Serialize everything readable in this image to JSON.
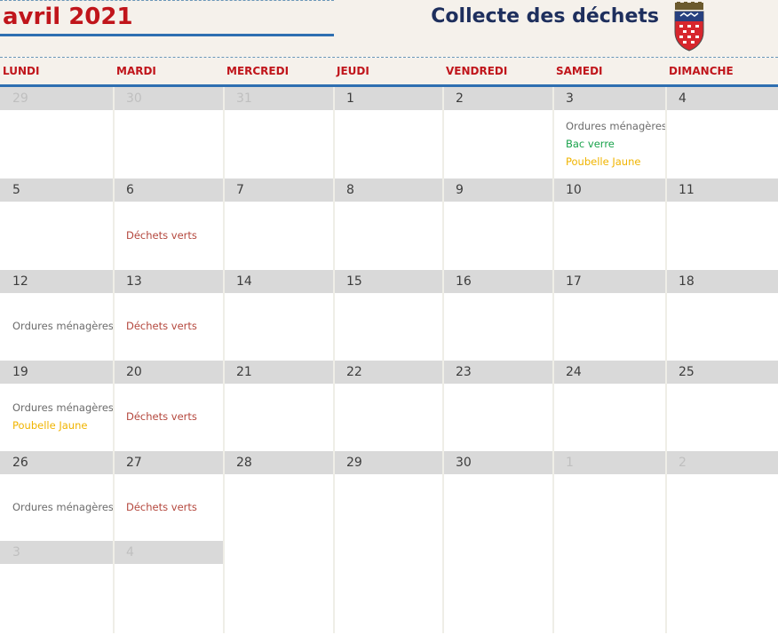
{
  "header": {
    "month_title": "avril 2021",
    "app_title": "Collecte des déchets",
    "crest_icon": "municipal-crest-icon"
  },
  "weekdays": [
    "LUNDI",
    "MARDI",
    "MERCREDI",
    "JEUDI",
    "VENDREDI",
    "SAMEDI",
    "DIMANCHE"
  ],
  "weeks": [
    [
      {
        "day": "29",
        "other_month": true,
        "events": []
      },
      {
        "day": "30",
        "other_month": true,
        "events": []
      },
      {
        "day": "31",
        "other_month": true,
        "events": []
      },
      {
        "day": "1",
        "other_month": false,
        "events": []
      },
      {
        "day": "2",
        "other_month": false,
        "events": []
      },
      {
        "day": "3",
        "other_month": false,
        "events": [
          {
            "label": "Ordures ménagères",
            "kind": "om"
          },
          {
            "label": "Bac verre",
            "kind": "verre"
          },
          {
            "label": "Poubelle Jaune",
            "kind": "jaune"
          }
        ]
      },
      {
        "day": "4",
        "other_month": false,
        "events": []
      }
    ],
    [
      {
        "day": "5",
        "other_month": false,
        "events": []
      },
      {
        "day": "6",
        "other_month": false,
        "events": [
          {
            "label": "Déchets verts",
            "kind": "verts"
          }
        ]
      },
      {
        "day": "7",
        "other_month": false,
        "events": []
      },
      {
        "day": "8",
        "other_month": false,
        "events": []
      },
      {
        "day": "9",
        "other_month": false,
        "events": []
      },
      {
        "day": "10",
        "other_month": false,
        "events": []
      },
      {
        "day": "11",
        "other_month": false,
        "events": []
      }
    ],
    [
      {
        "day": "12",
        "other_month": false,
        "events": [
          {
            "label": "Ordures ménagères",
            "kind": "om"
          }
        ]
      },
      {
        "day": "13",
        "other_month": false,
        "events": [
          {
            "label": "Déchets verts",
            "kind": "verts"
          }
        ]
      },
      {
        "day": "14",
        "other_month": false,
        "events": []
      },
      {
        "day": "15",
        "other_month": false,
        "events": []
      },
      {
        "day": "16",
        "other_month": false,
        "events": []
      },
      {
        "day": "17",
        "other_month": false,
        "events": []
      },
      {
        "day": "18",
        "other_month": false,
        "events": []
      }
    ],
    [
      {
        "day": "19",
        "other_month": false,
        "events": [
          {
            "label": "Ordures ménagères",
            "kind": "om"
          },
          {
            "label": "Poubelle Jaune",
            "kind": "jaune"
          }
        ]
      },
      {
        "day": "20",
        "other_month": false,
        "events": [
          {
            "label": "Déchets verts",
            "kind": "verts"
          }
        ]
      },
      {
        "day": "21",
        "other_month": false,
        "events": []
      },
      {
        "day": "22",
        "other_month": false,
        "events": []
      },
      {
        "day": "23",
        "other_month": false,
        "events": []
      },
      {
        "day": "24",
        "other_month": false,
        "events": []
      },
      {
        "day": "25",
        "other_month": false,
        "events": []
      }
    ],
    [
      {
        "day": "26",
        "other_month": false,
        "events": [
          {
            "label": "Ordures ménagères",
            "kind": "om"
          }
        ]
      },
      {
        "day": "27",
        "other_month": false,
        "events": [
          {
            "label": "Déchets verts",
            "kind": "verts"
          }
        ]
      },
      {
        "day": "28",
        "other_month": false,
        "events": []
      },
      {
        "day": "29",
        "other_month": false,
        "events": []
      },
      {
        "day": "30",
        "other_month": false,
        "events": []
      },
      {
        "day": "1",
        "other_month": true,
        "events": []
      },
      {
        "day": "2",
        "other_month": true,
        "events": []
      }
    ],
    [
      {
        "day": "3",
        "other_month": true,
        "events": []
      },
      {
        "day": "4",
        "other_month": true,
        "events": []
      }
    ]
  ],
  "colors": {
    "accent_red": "#c0151b",
    "rule_blue": "#2e6fb1",
    "header_bg": "#f5f1eb",
    "day_bar": "#d9d9d9",
    "ordures_menageres": "#6b6b6b",
    "bac_verre": "#19a24b",
    "poubelle_jaune": "#f0b400",
    "dechets_verts": "#b4473d"
  }
}
